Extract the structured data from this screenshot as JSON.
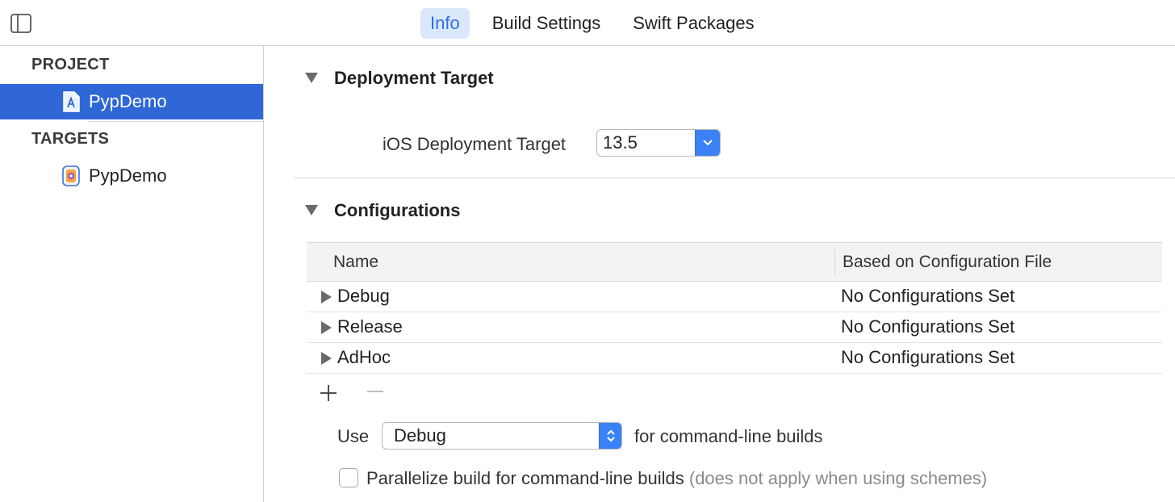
{
  "toolbar": {
    "tabs": [
      {
        "label": "Info",
        "active": true
      },
      {
        "label": "Build Settings",
        "active": false
      },
      {
        "label": "Swift Packages",
        "active": false
      }
    ]
  },
  "sidebar": {
    "project_heading": "PROJECT",
    "project_items": [
      {
        "label": "PypDemo",
        "icon": "xcode-project-icon",
        "selected": true
      }
    ],
    "targets_heading": "TARGETS",
    "target_items": [
      {
        "label": "PypDemo",
        "icon": "app-target-icon",
        "selected": false
      }
    ]
  },
  "deployment": {
    "title": "Deployment Target",
    "field_label": "iOS Deployment Target",
    "value": "13.5"
  },
  "configurations": {
    "title": "Configurations",
    "columns": [
      "Name",
      "Based on Configuration File"
    ],
    "rows": [
      {
        "name": "Debug",
        "file": "No Configurations Set"
      },
      {
        "name": "Release",
        "file": "No Configurations Set"
      },
      {
        "name": "AdHoc",
        "file": "No Configurations Set"
      }
    ],
    "use_label": "Use",
    "use_value": "Debug",
    "use_suffix": "for command-line builds",
    "parallelize_label": "Parallelize build for command-line builds",
    "parallelize_note": "(does not apply when using schemes)",
    "parallelize_checked": false
  },
  "colors": {
    "accent": "#2f67d6",
    "tab_active_bg": "#dbe7fb",
    "tab_active_text": "#2f6fe8",
    "popup_button": "#3b82f6"
  }
}
